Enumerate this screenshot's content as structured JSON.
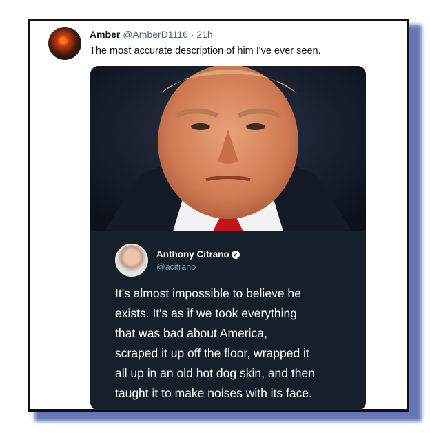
{
  "tweet": {
    "author_name": "Amber",
    "handle": "@AmberD1116",
    "separator": "·",
    "time": "21h",
    "text": "The most accurate description of him I've ever seen."
  },
  "quote": {
    "name": "Anthony Citrano",
    "verified_icon": "✔",
    "handle": "@acitrano",
    "lines": [
      "It's almost impossible to believe he",
      "exists. It's as if we took everything",
      "that was bad about America,",
      "scraped it up off the floor, wrapped it",
      "all up in an old hot dog skin, and then",
      "taught it to make noises with its face."
    ]
  },
  "colors": {
    "frame_shadow": "#4c5fa8",
    "card_bg": "#15202b",
    "tie": "#c0151d"
  }
}
